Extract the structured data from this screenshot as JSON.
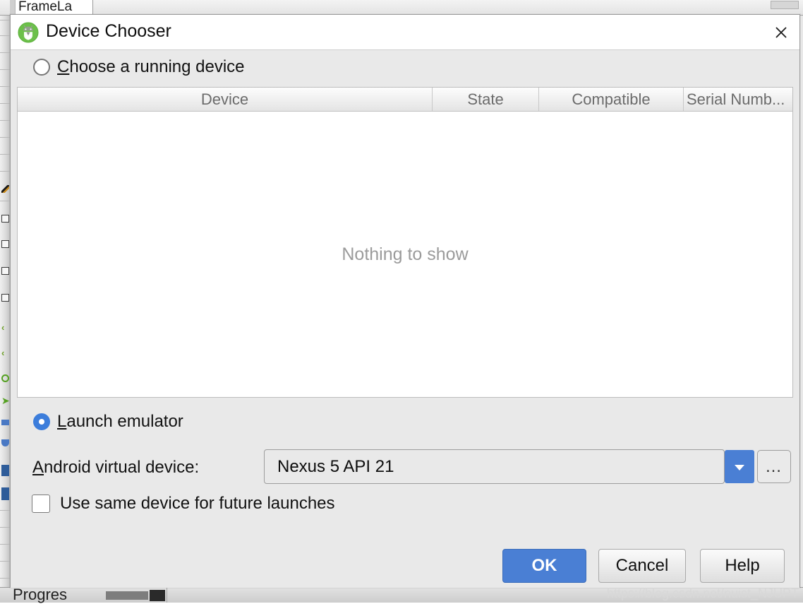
{
  "background": {
    "editor_tab_label": "FrameLa",
    "status_label": "Progres"
  },
  "dialog": {
    "title": "Device Chooser",
    "icon": "android-studio-icon",
    "close_icon": "close-icon",
    "running_device": {
      "label_prefix": "C",
      "label_rest": "hoose a running device",
      "selected": false
    },
    "device_table": {
      "columns": [
        "Device",
        "State",
        "Compatible",
        "Serial Numb..."
      ],
      "rows": [],
      "empty_message": "Nothing to show"
    },
    "launch_emulator": {
      "label_prefix": "L",
      "label_rest": "aunch emulator",
      "selected": true
    },
    "avd": {
      "label_prefix": "A",
      "label_rest": "ndroid virtual device:",
      "value": "Nexus 5 API 21",
      "dropdown_icon": "chevron-down-icon",
      "more_label": "…"
    },
    "future_launches": {
      "label": "Use same device for future launches",
      "checked": false
    },
    "buttons": {
      "ok": "OK",
      "cancel": "Cancel",
      "help": "Help"
    }
  },
  "watermark": "https://blog.csdn.net/nuist_NJUPT",
  "colors": {
    "accent_blue": "#4a7fd4",
    "dialog_bg": "#e9e9e9",
    "header_text": "#6b6b6b",
    "empty_text": "#9b9b9b"
  }
}
